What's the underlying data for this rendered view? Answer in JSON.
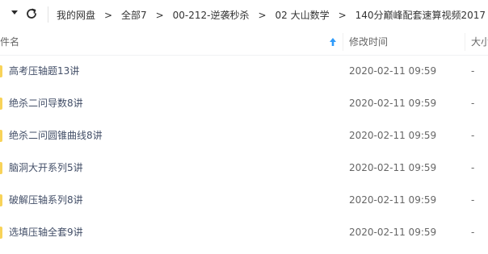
{
  "toolbar": {
    "dropdown_icon": "caret-down-icon",
    "refresh_icon": "refresh-icon"
  },
  "breadcrumb": {
    "items": [
      "我的网盘",
      "全部7",
      "00-212-逆袭秒杀",
      "02 大山数学",
      "140分巅峰配套速算视频2017"
    ],
    "separator": ">"
  },
  "columns": {
    "name": "件名",
    "modified": "修改时间",
    "size": "大小",
    "sort_icon": "sort-ascending-arrow-icon",
    "accent_color": "#2f9bfa"
  },
  "files": [
    {
      "name": "高考压轴题13讲",
      "modified": "2020-02-11 09:59",
      "size": "-"
    },
    {
      "name": "绝杀二问导数8讲",
      "modified": "2020-02-11 09:59",
      "size": "-"
    },
    {
      "name": "绝杀二问圆锥曲线8讲",
      "modified": "2020-02-11 09:59",
      "size": "-"
    },
    {
      "name": "脑洞大开系列5讲",
      "modified": "2020-02-11 09:59",
      "size": "-"
    },
    {
      "name": "破解压轴系列8讲",
      "modified": "2020-02-11 09:59",
      "size": "-"
    },
    {
      "name": "选填压轴全套9讲",
      "modified": "2020-02-11 09:59",
      "size": "-"
    }
  ],
  "folder_marker_color": "#f8d359"
}
